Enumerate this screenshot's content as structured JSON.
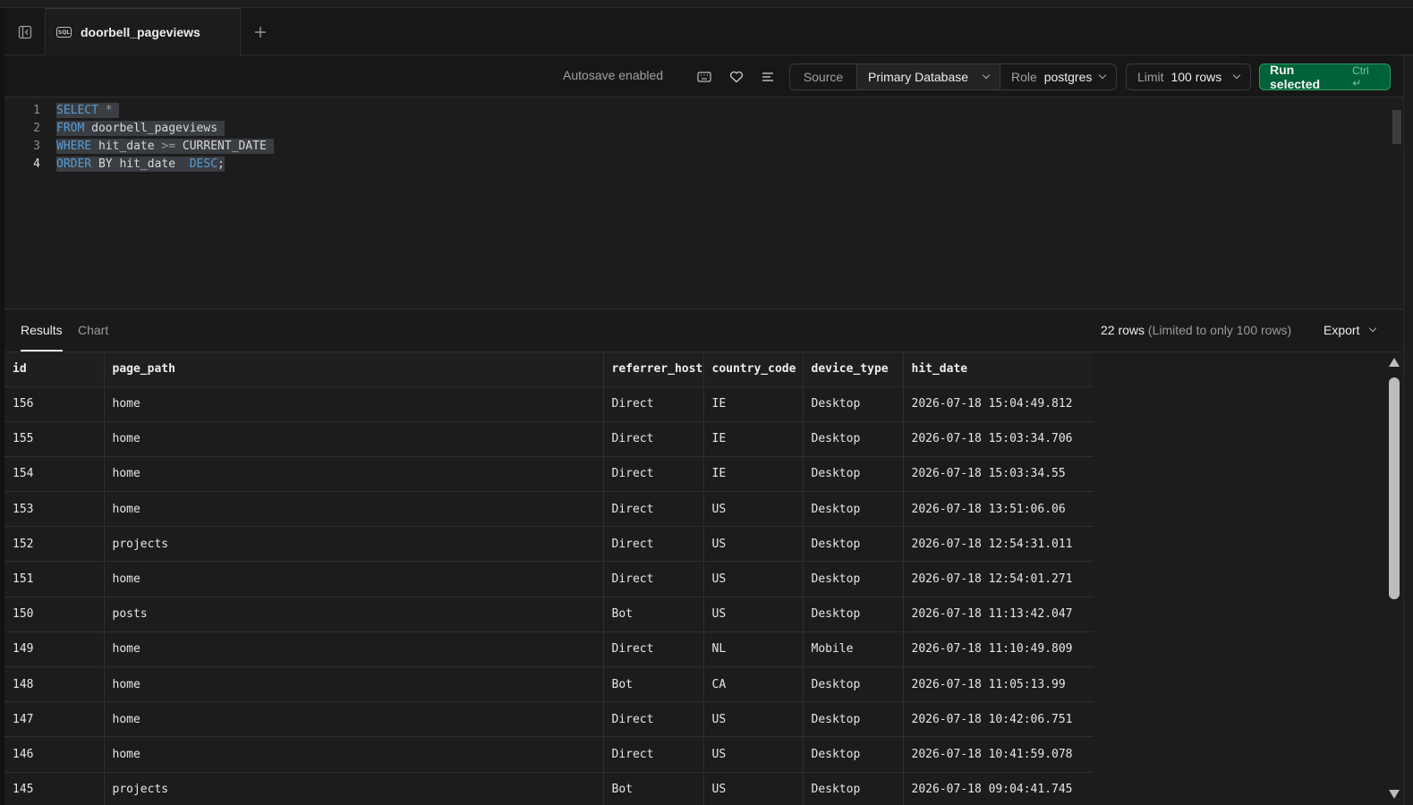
{
  "tab": {
    "title": "doorbell_pageviews",
    "icon": "sql-file-icon",
    "badge": "SQL"
  },
  "toolbar": {
    "autosave": "Autosave enabled",
    "source_label": "Source",
    "database": "Primary Database",
    "role_label": "Role",
    "role_value": "postgres",
    "limit_label": "Limit",
    "limit_value": "100 rows",
    "run_label": "Run selected",
    "run_shortcut": "Ctrl ↵"
  },
  "editor": {
    "lines": [
      {
        "n": "1",
        "text": "SELECT * "
      },
      {
        "n": "2",
        "text": "FROM doorbell_pageviews "
      },
      {
        "n": "3",
        "text": "WHERE hit_date >= CURRENT_DATE "
      },
      {
        "n": "4",
        "text": "ORDER BY hit_date  DESC;"
      }
    ]
  },
  "results": {
    "tabs": [
      "Results",
      "Chart"
    ],
    "row_count": "22 rows",
    "row_note": "(Limited to only 100 rows)",
    "export_label": "Export",
    "columns": [
      "id",
      "page_path",
      "referrer_host",
      "country_code",
      "device_type",
      "hit_date"
    ],
    "rows": [
      [
        "156",
        "home",
        "Direct",
        "IE",
        "Desktop",
        "2026-07-18 15:04:49.812"
      ],
      [
        "155",
        "home",
        "Direct",
        "IE",
        "Desktop",
        "2026-07-18 15:03:34.706"
      ],
      [
        "154",
        "home",
        "Direct",
        "IE",
        "Desktop",
        "2026-07-18 15:03:34.55"
      ],
      [
        "153",
        "home",
        "Direct",
        "US",
        "Desktop",
        "2026-07-18 13:51:06.06"
      ],
      [
        "152",
        "projects",
        "Direct",
        "US",
        "Desktop",
        "2026-07-18 12:54:31.011"
      ],
      [
        "151",
        "home",
        "Direct",
        "US",
        "Desktop",
        "2026-07-18 12:54:01.271"
      ],
      [
        "150",
        "posts",
        "Bot",
        "US",
        "Desktop",
        "2026-07-18 11:13:42.047"
      ],
      [
        "149",
        "home",
        "Direct",
        "NL",
        "Mobile",
        "2026-07-18 11:10:49.809"
      ],
      [
        "148",
        "home",
        "Bot",
        "CA",
        "Desktop",
        "2026-07-18 11:05:13.99"
      ],
      [
        "147",
        "home",
        "Direct",
        "US",
        "Desktop",
        "2026-07-18 10:42:06.751"
      ],
      [
        "146",
        "home",
        "Direct",
        "US",
        "Desktop",
        "2026-07-18 10:41:59.078"
      ],
      [
        "145",
        "projects",
        "Bot",
        "US",
        "Desktop",
        "2026-07-18 09:04:41.745"
      ]
    ]
  },
  "icons": {
    "sidebar": "sidebar-collapse-icon",
    "add_tab": "plus-icon",
    "keyboard": "keyboard-icon",
    "favorite": "heart-icon",
    "format": "align-left-icon"
  },
  "colors": {
    "run_button": "#006239",
    "keyword": "#569cd6",
    "background": "#1c1c1c"
  }
}
